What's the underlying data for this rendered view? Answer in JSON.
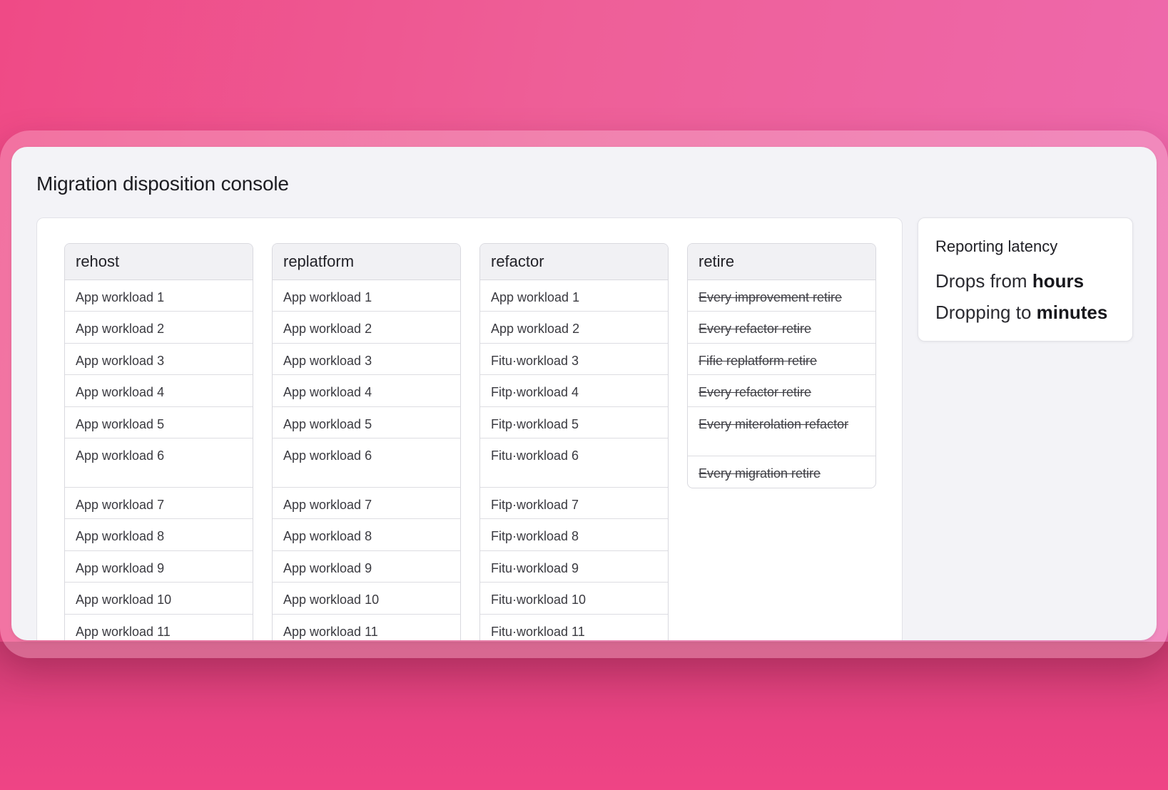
{
  "window": {
    "title": "Migration disposition console"
  },
  "columns": [
    {
      "title": "rehost",
      "cards": [
        "App workload 1",
        "App workload 2",
        "App workload 3",
        "App workload 4",
        "App workload 5",
        "App workload 6",
        "App workload 7",
        "App workload 8",
        "App workload 9",
        "App workload 10",
        "App workload 11"
      ]
    },
    {
      "title": "replatform",
      "cards": [
        "App workload 1",
        "App workload 2",
        "App workload 3",
        "App workload 4",
        "App workload 5",
        "App workload 6",
        "App workload 7",
        "App workload 8",
        "App workload 9",
        "App workload 10",
        "App workload 11"
      ]
    },
    {
      "title": "refactor",
      "cards": [
        "App workload 1",
        "App workload 2",
        "Fitu·workload 3",
        "Fitp·workload 4",
        "Fitp·workload 5",
        "Fitu·workload 6",
        "Fitp·workload 7",
        "Fitp·workload 8",
        "Fitu·workload 9",
        "Fitu·workload 10",
        "Fitu·workload 11"
      ]
    },
    {
      "title": "retire",
      "cards": [
        "Every improvement retire",
        "Every refactor retire",
        "Fifie replatform retire",
        "Every refactor retire",
        "Every miterolation refactor",
        "Every migration retire"
      ]
    }
  ],
  "panel": {
    "title": "Reporting latency",
    "line1_prefix": "Drops from ",
    "line1_bold": "hours",
    "line2_prefix": "Dropping to ",
    "line2_bold": "minutes"
  }
}
